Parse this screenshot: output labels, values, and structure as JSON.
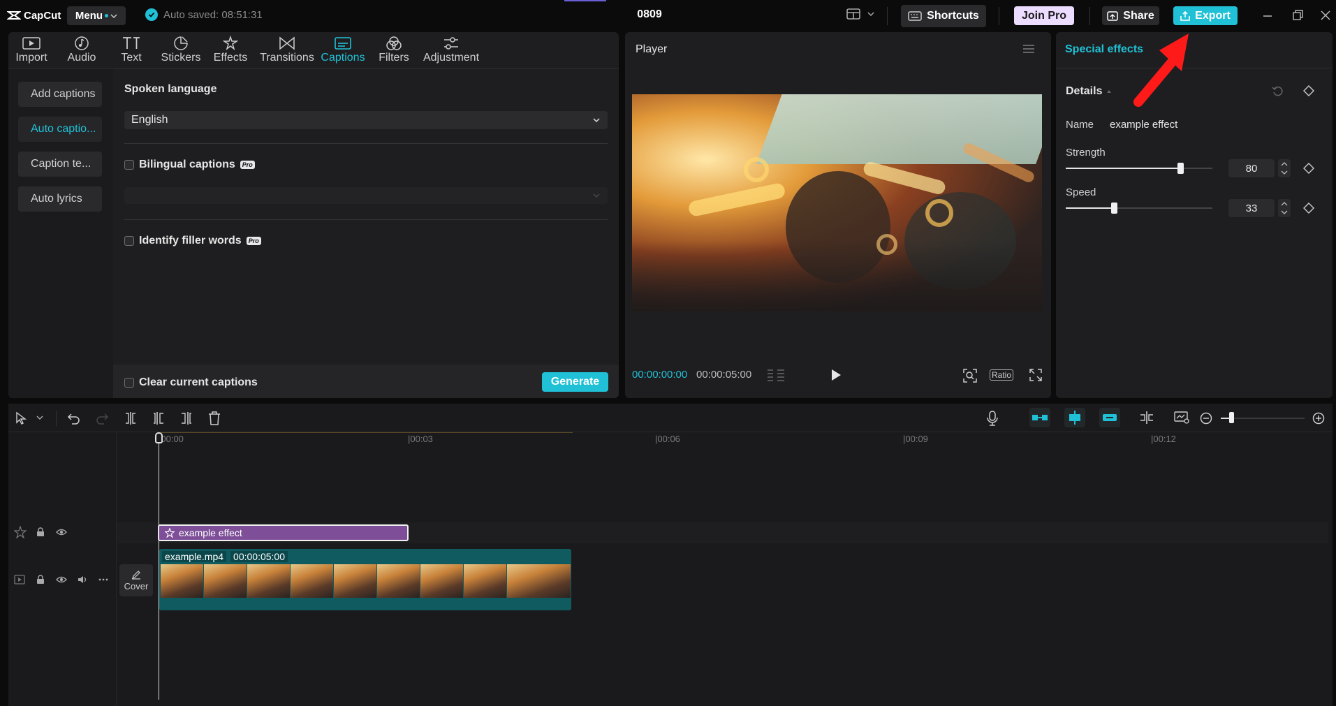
{
  "app": {
    "name": "CapCut",
    "menu_label": "Menu",
    "autosave_text": "Auto saved: 08:51:31",
    "project_title": "0809"
  },
  "toolbar": {
    "shortcuts_label": "Shortcuts",
    "join_pro_label": "Join Pro",
    "share_label": "Share",
    "export_label": "Export"
  },
  "nav": {
    "items": [
      {
        "label": "Import",
        "icon": "import-icon"
      },
      {
        "label": "Audio",
        "icon": "audio-icon"
      },
      {
        "label": "Text",
        "icon": "text-icon"
      },
      {
        "label": "Stickers",
        "icon": "stickers-icon"
      },
      {
        "label": "Effects",
        "icon": "effects-icon"
      },
      {
        "label": "Transitions",
        "icon": "transitions-icon"
      },
      {
        "label": "Captions",
        "icon": "captions-icon",
        "active": true
      },
      {
        "label": "Filters",
        "icon": "filters-icon"
      },
      {
        "label": "Adjustment",
        "icon": "adjustment-icon"
      }
    ]
  },
  "captions": {
    "side": [
      "Add captions",
      "Auto captio...",
      "Caption te...",
      "Auto lyrics"
    ],
    "spoken_language_label": "Spoken language",
    "language_value": "English",
    "bilingual_label": "Bilingual captions",
    "pro_badge": "Pro",
    "filler_label": "Identify filler words",
    "clear_label": "Clear current captions",
    "generate_label": "Generate"
  },
  "player": {
    "title": "Player",
    "current_time": "00:00:00:00",
    "total_time": "00:00:05:00",
    "ratio_label": "Ratio"
  },
  "effects_panel": {
    "title": "Special effects",
    "details_label": "Details",
    "name_label": "Name",
    "name_value": "example effect",
    "strength_label": "Strength",
    "strength_value": "80",
    "speed_label": "Speed",
    "speed_value": "33"
  },
  "timeline": {
    "ruler": [
      "|00:00",
      "|00:03",
      "|00:06",
      "|00:09",
      "|00:12"
    ],
    "effect_clip_label": "example effect",
    "video_clip_name": "example.mp4",
    "video_clip_duration": "00:00:05:00",
    "cover_label": "Cover"
  },
  "colors": {
    "accent": "#20c1d6",
    "effect_clip": "#7e4f98",
    "video_clip": "#0f5b60",
    "arrow": "#ff1a1a"
  }
}
